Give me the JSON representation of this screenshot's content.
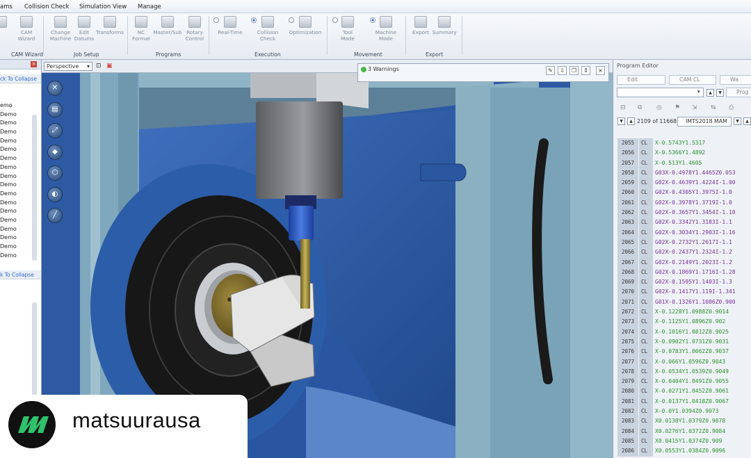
{
  "ribbon": {
    "tabs": [
      "ams",
      "Collision Check",
      "Simulation View",
      "Manage"
    ],
    "buttons": {
      "cam_wizard": "CAM\nWizard",
      "change_machine": "Change\nMachine",
      "edit_datums": "Edit\nDatums",
      "transforms": "Transforms",
      "nc_format": "NC\nFormat",
      "master_sub": "Master/Sub",
      "rotary_control": "Rotary\nControl",
      "real_time": "Real-Time",
      "collision_check": "Collision\nCheck",
      "optimization": "Optimization",
      "tool_mode": "Tool\nMode",
      "machine_mode": "Machine\nMode",
      "export": "Export",
      "summary": "Summary"
    },
    "groups": {
      "cam_wizard": "CAM Wizard",
      "job_setup": "Job Setup",
      "programs": "Programs",
      "execution": "Execution",
      "movement": "Movement",
      "export": "Export"
    }
  },
  "left_panel": {
    "collapse_top": "ck To Collapse",
    "collapse_bottom": "k To Collapse",
    "items": [
      "emo",
      "Demo",
      "Demo",
      "Demo",
      "Demo",
      "Demo",
      "Demo",
      "Demo",
      "Demo",
      "Demo",
      "Demo",
      "Demo",
      "Demo",
      "Demo",
      "Demo",
      "Demo",
      "Demo",
      "Demo"
    ]
  },
  "viewport": {
    "view_mode": "Perspective",
    "warnings": "3 Warnings"
  },
  "program_editor": {
    "title": "Program Editor",
    "edit_label": "Edit",
    "cam_cl_label": "CAM CL",
    "warn_label": "Wa",
    "prog_label": "Prog",
    "position": "2109 of 11668",
    "file": "IMTS2018 MAM",
    "lines": [
      {
        "n": "2055",
        "t": "CL",
        "c": "X-0.5743Y1.5317",
        "g": false
      },
      {
        "n": "2056",
        "t": "CL",
        "c": "X-0.5366Y1.4892",
        "g": false
      },
      {
        "n": "2057",
        "t": "CL",
        "c": "X-0.513Y1.4605",
        "g": false
      },
      {
        "n": "2058",
        "t": "CL",
        "c": "G03X-0.4978Y1.4465Z0.053",
        "g": true
      },
      {
        "n": "2059",
        "t": "CL",
        "c": "G02X-0.4639Y1.4224I-1.00",
        "g": true
      },
      {
        "n": "2060",
        "t": "CL",
        "c": "G02X-0.4305Y1.3975I-1.0",
        "g": true
      },
      {
        "n": "2061",
        "t": "CL",
        "c": "G02X-0.3978Y1.3719I-1.0",
        "g": true
      },
      {
        "n": "2062",
        "t": "CL",
        "c": "G02X-0.3657Y1.3454I-1.10",
        "g": true
      },
      {
        "n": "2063",
        "t": "CL",
        "c": "G02X-0.3342Y1.3183I-1.1",
        "g": true
      },
      {
        "n": "2064",
        "t": "CL",
        "c": "G02X-0.3034Y1.2903I-1.16",
        "g": true
      },
      {
        "n": "2065",
        "t": "CL",
        "c": "G02X-0.2732Y1.2617I-1.1",
        "g": true
      },
      {
        "n": "2066",
        "t": "CL",
        "c": "G02X-0.2437Y1.2324I-1.2",
        "g": true
      },
      {
        "n": "2067",
        "t": "CL",
        "c": "G02X-0.2149Y1.2023I-1.2",
        "g": true
      },
      {
        "n": "2068",
        "t": "CL",
        "c": "G02X-0.1869Y1.1716I-1.28",
        "g": true
      },
      {
        "n": "2069",
        "t": "CL",
        "c": "G02X-0.1595Y1.1403I-1.3",
        "g": true
      },
      {
        "n": "2070",
        "t": "CL",
        "c": "G02X-0.1417Y1.119I-1.341",
        "g": true
      },
      {
        "n": "2071",
        "t": "CL",
        "c": "G01X-0.1326Y1.1086Z0.900",
        "g": true
      },
      {
        "n": "2072",
        "t": "CL",
        "c": "X-0.1228Y1.0988Z0.9014",
        "g": false
      },
      {
        "n": "2073",
        "t": "CL",
        "c": "X-0.1125Y1.0896Z0.902",
        "g": false
      },
      {
        "n": "2074",
        "t": "CL",
        "c": "X-0.1016Y1.0812Z0.9025",
        "g": false
      },
      {
        "n": "2075",
        "t": "CL",
        "c": "X-0.0902Y1.0731Z0.9031",
        "g": false
      },
      {
        "n": "2076",
        "t": "CL",
        "c": "X-0.0783Y1.0662Z0.9037",
        "g": false
      },
      {
        "n": "2077",
        "t": "CL",
        "c": "X-0.066Y1.0596Z0.9043",
        "g": false
      },
      {
        "n": "2078",
        "t": "CL",
        "c": "X-0.0534Y1.0539Z0.9049",
        "g": false
      },
      {
        "n": "2079",
        "t": "CL",
        "c": "X-0.0404Y1.0491Z0.9055",
        "g": false
      },
      {
        "n": "2080",
        "t": "CL",
        "c": "X-0.0271Y1.0452Z0.9061",
        "g": false
      },
      {
        "n": "2081",
        "t": "CL",
        "c": "X-0.0137Y1.0418Z0.9067",
        "g": false
      },
      {
        "n": "2082",
        "t": "CL",
        "c": "X-0.0Y1.0394Z0.9073",
        "g": false
      },
      {
        "n": "2083",
        "t": "CL",
        "c": "X0.0138Y1.0379Z0.9078",
        "g": false
      },
      {
        "n": "2084",
        "t": "CL",
        "c": "X0.0276Y1.0372Z0.9084",
        "g": false
      },
      {
        "n": "2085",
        "t": "CL",
        "c": "X0.0415Y1.0374Z0.909",
        "g": false
      },
      {
        "n": "2086",
        "t": "CL",
        "c": "X0.0553Y1.0384Z0.9096",
        "g": false
      }
    ]
  },
  "brand": {
    "name": "matsuurausa",
    "logo_color": "#2ec26a"
  }
}
